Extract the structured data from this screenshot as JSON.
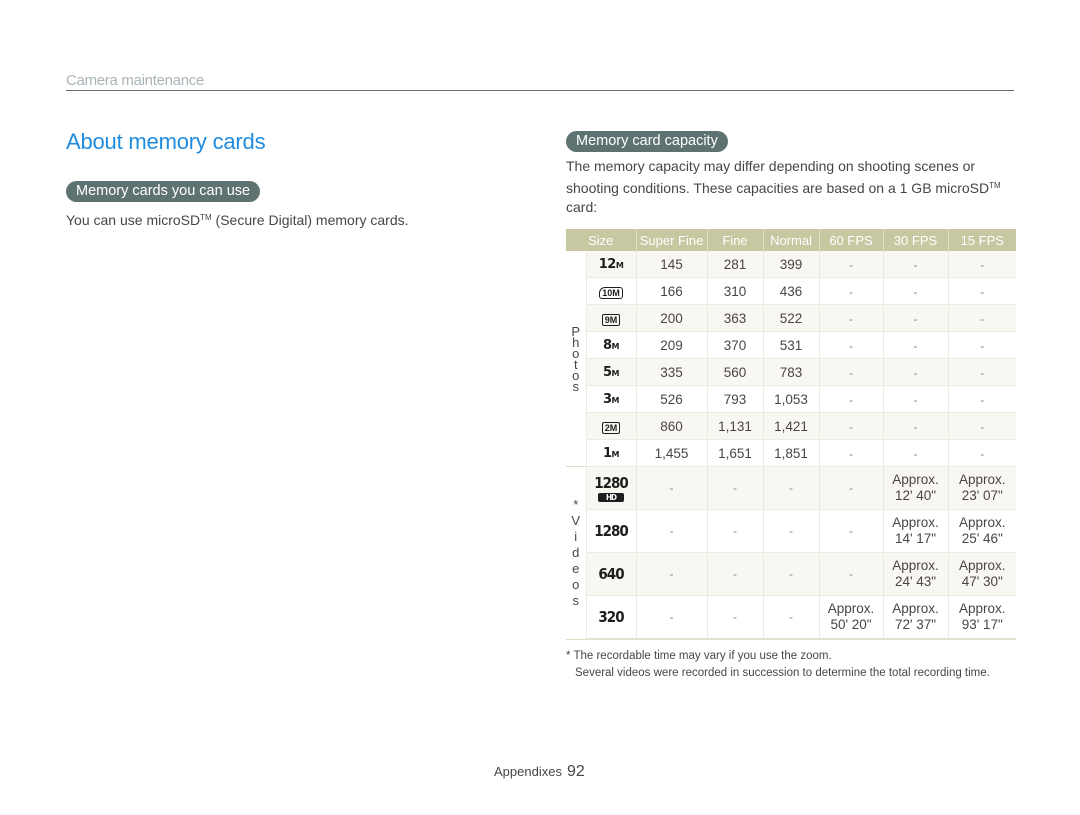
{
  "header": {
    "section": "Camera maintenance"
  },
  "page_title": "About memory cards",
  "left": {
    "pill": "Memory cards you can use",
    "text_pre": "You can use microSD",
    "text_tm": "TM",
    "text_post": " (Secure Digital) memory cards."
  },
  "right": {
    "pill": "Memory card capacity",
    "text_pre": "The memory capacity may differ depending on shooting scenes or shooting conditions. These capacities are based on a 1 GB microSD",
    "text_tm": "TM",
    "text_post": " card:"
  },
  "table": {
    "headers": [
      "Size",
      "Super Fine",
      "Fine",
      "Normal",
      "60 FPS",
      "30 FPS",
      "15 FPS"
    ],
    "photos_label": "P\nh\no\nt\no\ns",
    "videos_label": "*\nV\ni\nd\ne\no\ns",
    "photo_rows": [
      {
        "size_icon": "12M",
        "values": [
          "145",
          "281",
          "399",
          "-",
          "-",
          "-"
        ]
      },
      {
        "size_icon": "10M",
        "values": [
          "166",
          "310",
          "436",
          "-",
          "-",
          "-"
        ]
      },
      {
        "size_icon": "9M",
        "values": [
          "200",
          "363",
          "522",
          "-",
          "-",
          "-"
        ]
      },
      {
        "size_icon": "8M",
        "values": [
          "209",
          "370",
          "531",
          "-",
          "-",
          "-"
        ]
      },
      {
        "size_icon": "5M",
        "values": [
          "335",
          "560",
          "783",
          "-",
          "-",
          "-"
        ]
      },
      {
        "size_icon": "3M",
        "values": [
          "526",
          "793",
          "1,053",
          "-",
          "-",
          "-"
        ]
      },
      {
        "size_icon": "2M",
        "values": [
          "860",
          "1,131",
          "1,421",
          "-",
          "-",
          "-"
        ]
      },
      {
        "size_icon": "1M",
        "values": [
          "1,455",
          "1,651",
          "1,851",
          "-",
          "-",
          "-"
        ]
      }
    ],
    "video_rows": [
      {
        "size_icon": "1280",
        "hd": "HD",
        "values": [
          "-",
          "-",
          "-",
          "-",
          "Approx.\n12' 40\"",
          "Approx.\n23' 07\""
        ]
      },
      {
        "size_icon": "1280",
        "values": [
          "-",
          "-",
          "-",
          "-",
          "Approx.\n14' 17\"",
          "Approx.\n25' 46\""
        ]
      },
      {
        "size_icon": "640",
        "values": [
          "-",
          "-",
          "-",
          "-",
          "Approx.\n24' 43\"",
          "Approx.\n47' 30\""
        ]
      },
      {
        "size_icon": "320",
        "values": [
          "-",
          "-",
          "-",
          "Approx.\n50' 20\"",
          "Approx.\n72' 37\"",
          "Approx.\n93' 17\""
        ]
      }
    ]
  },
  "footnote": {
    "line1": "* The recordable time may vary if you use the zoom.",
    "line2": "Several videos were recorded in succession to determine the total recording time."
  },
  "footer": {
    "label": "Appendixes",
    "page": "92"
  },
  "colors": {
    "title": "#1f8ce0",
    "pill": "#5f7272",
    "table_header": "#c7c7a2",
    "row_shade": "#f8f7f2"
  }
}
